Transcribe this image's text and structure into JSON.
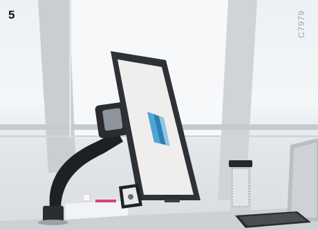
{
  "step_number": "5",
  "code": "C7979",
  "colors": {
    "monitor_frame": "#2e3136",
    "screen": "#f0eeec",
    "arm": "#1e2024",
    "accent_blue": "#4da6d8"
  }
}
